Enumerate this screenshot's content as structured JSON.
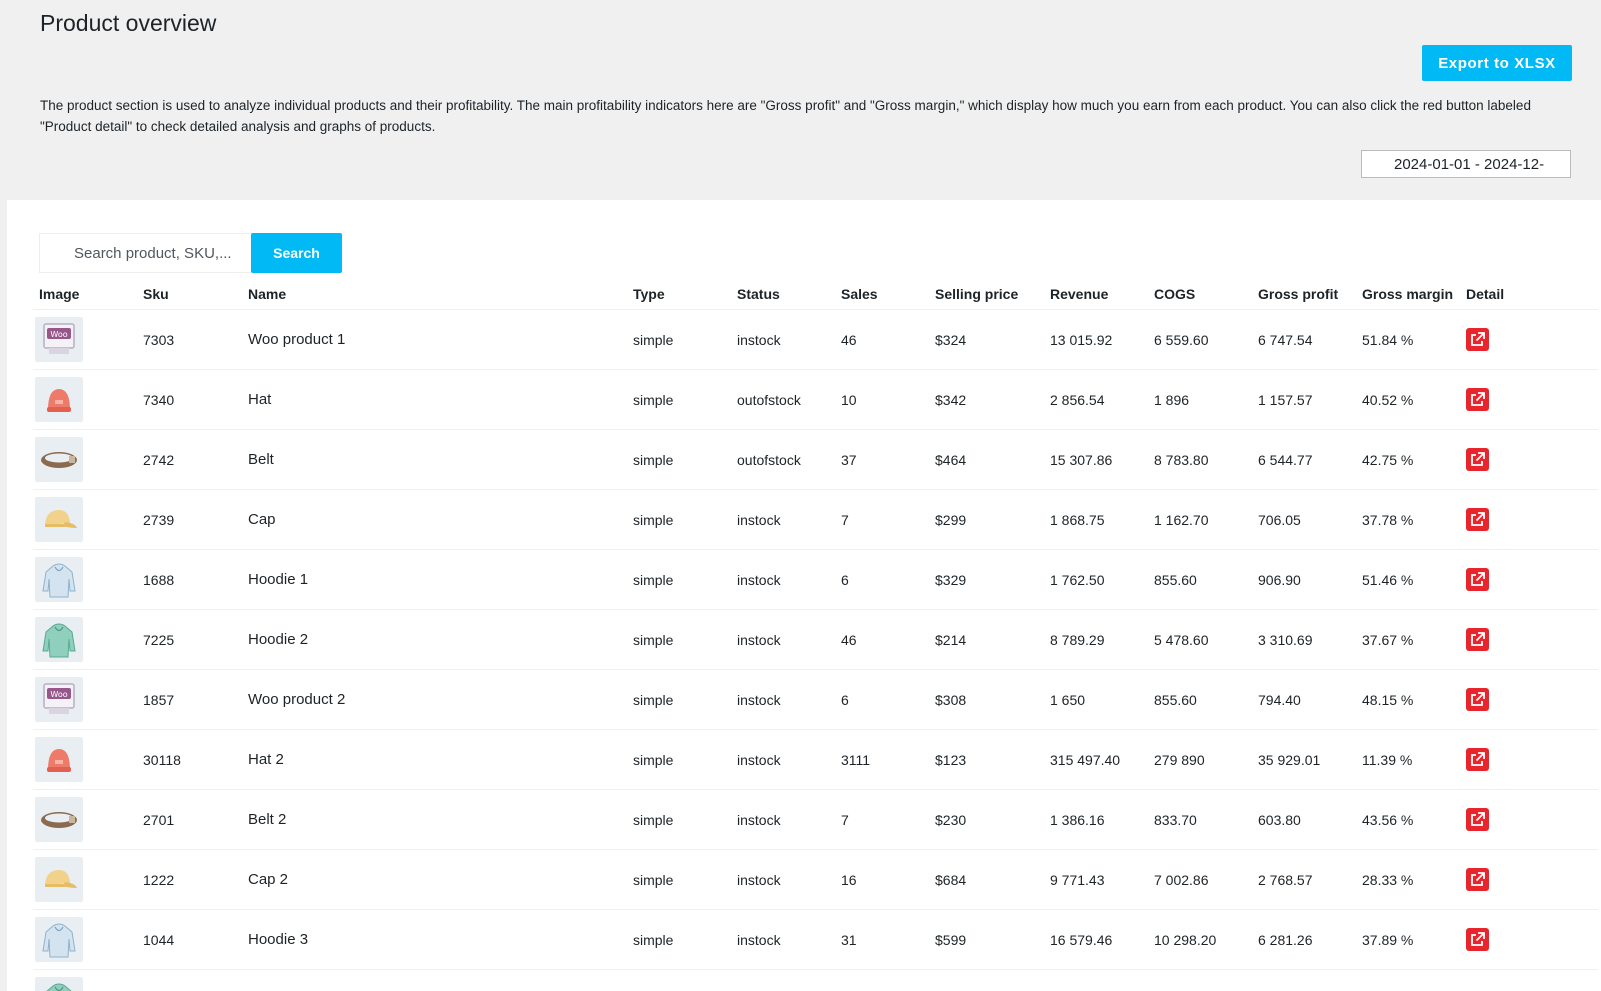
{
  "header": {
    "title": "Product overview",
    "export_label": "Export to XLSX",
    "description": "The product section is used to analyze individual products and their profitability. The main profitability indicators here are \"Gross profit\" and \"Gross margin,\" which display how much you earn from each product. You can also click the red button labeled \"Product detail\" to check detailed analysis and graphs of products.",
    "date_range": "2024-01-01 - 2024-12-"
  },
  "search": {
    "placeholder": "Search product, SKU,...",
    "value": "",
    "button_label": "Search"
  },
  "colors": {
    "accent": "#00b9f5",
    "detail_red": "#e8242c",
    "background": "#f0f0f1"
  },
  "table": {
    "columns": [
      "Image",
      "Sku",
      "Name",
      "Type",
      "Status",
      "Sales",
      "Selling price",
      "Revenue",
      "COGS",
      "Gross profit",
      "Gross margin",
      "Detail"
    ],
    "rows": [
      {
        "image": "woo-box",
        "sku": "7303",
        "name": "Woo product 1",
        "type": "simple",
        "status": "instock",
        "sales": "46",
        "price": "$324",
        "revenue": "13 015.92",
        "cogs": "6 559.60",
        "profit": "6 747.54",
        "margin": "51.84 %"
      },
      {
        "image": "hat",
        "sku": "7340",
        "name": "Hat",
        "type": "simple",
        "status": "outofstock",
        "sales": "10",
        "price": "$342",
        "revenue": "2 856.54",
        "cogs": "1 896",
        "profit": "1 157.57",
        "margin": "40.52 %"
      },
      {
        "image": "belt",
        "sku": "2742",
        "name": "Belt",
        "type": "simple",
        "status": "outofstock",
        "sales": "37",
        "price": "$464",
        "revenue": "15 307.86",
        "cogs": "8 783.80",
        "profit": "6 544.77",
        "margin": "42.75 %"
      },
      {
        "image": "cap",
        "sku": "2739",
        "name": "Cap",
        "type": "simple",
        "status": "instock",
        "sales": "7",
        "price": "$299",
        "revenue": "1 868.75",
        "cogs": "1 162.70",
        "profit": "706.05",
        "margin": "37.78 %"
      },
      {
        "image": "hoodie-blue",
        "sku": "1688",
        "name": "Hoodie 1",
        "type": "simple",
        "status": "instock",
        "sales": "6",
        "price": "$329",
        "revenue": "1 762.50",
        "cogs": "855.60",
        "profit": "906.90",
        "margin": "51.46 %"
      },
      {
        "image": "hoodie-green",
        "sku": "7225",
        "name": "Hoodie 2",
        "type": "simple",
        "status": "instock",
        "sales": "46",
        "price": "$214",
        "revenue": "8 789.29",
        "cogs": "5 478.60",
        "profit": "3 310.69",
        "margin": "37.67 %"
      },
      {
        "image": "woo-box",
        "sku": "1857",
        "name": "Woo product 2",
        "type": "simple",
        "status": "instock",
        "sales": "6",
        "price": "$308",
        "revenue": "1 650",
        "cogs": "855.60",
        "profit": "794.40",
        "margin": "48.15 %"
      },
      {
        "image": "hat",
        "sku": "30118",
        "name": "Hat 2",
        "type": "simple",
        "status": "instock",
        "sales": "3111",
        "price": "$123",
        "revenue": "315 497.40",
        "cogs": "279 890",
        "profit": "35 929.01",
        "margin": "11.39 %"
      },
      {
        "image": "belt",
        "sku": "2701",
        "name": "Belt 2",
        "type": "simple",
        "status": "instock",
        "sales": "7",
        "price": "$230",
        "revenue": "1 386.16",
        "cogs": "833.70",
        "profit": "603.80",
        "margin": "43.56 %"
      },
      {
        "image": "cap",
        "sku": "1222",
        "name": "Cap 2",
        "type": "simple",
        "status": "instock",
        "sales": "16",
        "price": "$684",
        "revenue": "9 771.43",
        "cogs": "7 002.86",
        "profit": "2 768.57",
        "margin": "28.33 %"
      },
      {
        "image": "hoodie-blue",
        "sku": "1044",
        "name": "Hoodie 3",
        "type": "simple",
        "status": "instock",
        "sales": "31",
        "price": "$599",
        "revenue": "16 579.46",
        "cogs": "10 298.20",
        "profit": "6 281.26",
        "margin": "37.89 %"
      },
      {
        "image": "hoodie-green",
        "sku": "",
        "name": "",
        "type": "",
        "status": "",
        "sales": "",
        "price": "",
        "revenue": "",
        "cogs": "",
        "profit": "",
        "margin": ""
      }
    ]
  }
}
